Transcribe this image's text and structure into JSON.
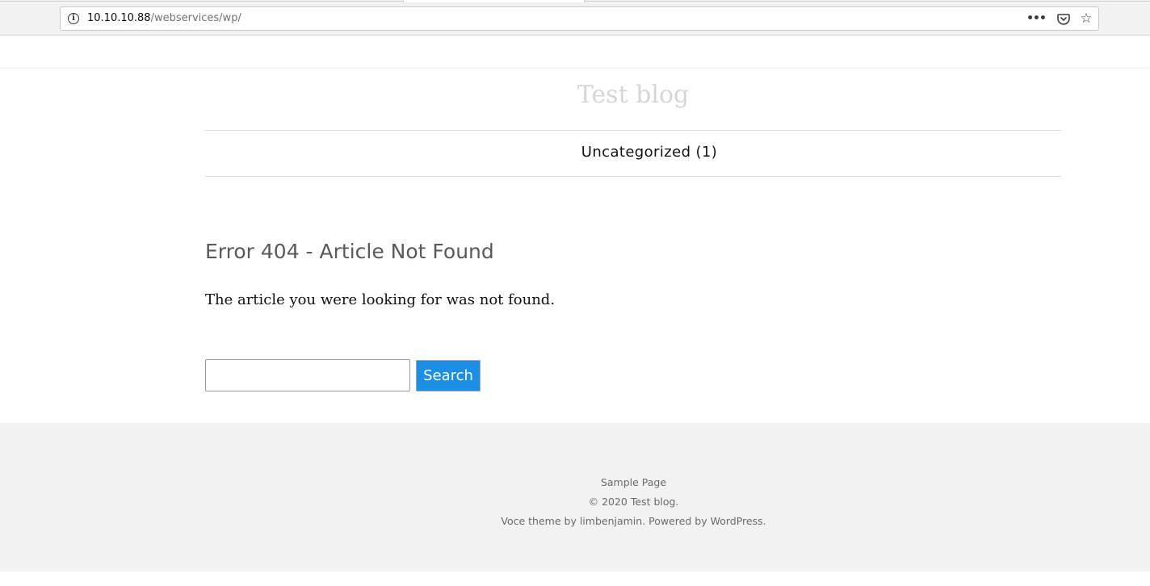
{
  "browser": {
    "url_host": "10.10.10.88",
    "url_path": "/webservices/wp/",
    "icons": {
      "info": "info-icon",
      "more": "more-actions-icon",
      "pocket": "pocket-icon",
      "bookmark": "star-icon"
    }
  },
  "site": {
    "title": "Test blog",
    "nav_category": "Uncategorized (1)"
  },
  "main": {
    "error_title": "Error 404 - Article Not Found",
    "error_message": "The article you were looking for was not found.",
    "search": {
      "input_value": "",
      "button_label": "Search"
    }
  },
  "footer": {
    "sample_page": "Sample Page",
    "copyright": "© 2020 Test blog.",
    "credits_prefix": "Voce theme by ",
    "theme_author": "limbenjamin",
    "credits_middle": ". Powered by ",
    "powered_by": "WordPress",
    "credits_suffix": "."
  },
  "colors": {
    "accent_button": "#1a8fe3",
    "footer_bg": "#f2f2f2",
    "site_title": "#d6d6d6"
  }
}
